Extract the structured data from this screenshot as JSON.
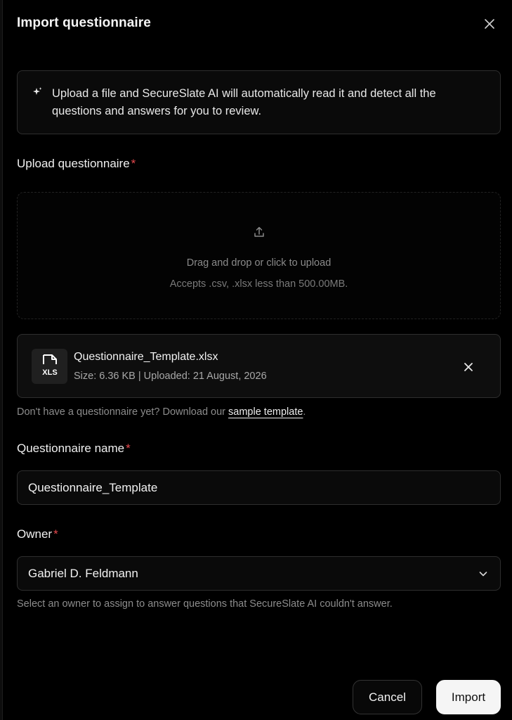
{
  "dialog": {
    "title": "Import questionnaire"
  },
  "info": {
    "text": "Upload a file and SecureSlate AI will automatically read it and detect all the questions and answers for you to review."
  },
  "upload": {
    "label": "Upload questionnaire",
    "required_mark": "*",
    "dropzone_text": "Drag and drop or click to upload",
    "accepts_text": "Accepts .csv, .xlsx less than 500.00MB."
  },
  "file": {
    "type_badge": "XLS",
    "name": "Questionnaire_Template.xlsx",
    "meta": "Size: 6.36 KB | Uploaded: 21 August, 2026"
  },
  "hint": {
    "prefix": "Don't have a questionnaire yet? Download our ",
    "link": "sample template",
    "suffix": "."
  },
  "name_field": {
    "label": "Questionnaire name",
    "required_mark": "*",
    "value": "Questionnaire_Template"
  },
  "owner_field": {
    "label": "Owner",
    "required_mark": "*",
    "value": "Gabriel D. Feldmann",
    "hint": "Select an owner to assign to answer questions that SecureSlate AI couldn't answer."
  },
  "actions": {
    "cancel": "Cancel",
    "import": "Import"
  },
  "colors": {
    "background": "#000000",
    "required": "#e5484d",
    "primary_button": "#f5f5f5"
  },
  "icons": {
    "close": "close-icon",
    "sparkle": "sparkle-icon",
    "upload": "upload-icon",
    "file": "xls-file-icon",
    "remove": "close-icon",
    "chevron": "chevron-down-icon"
  }
}
